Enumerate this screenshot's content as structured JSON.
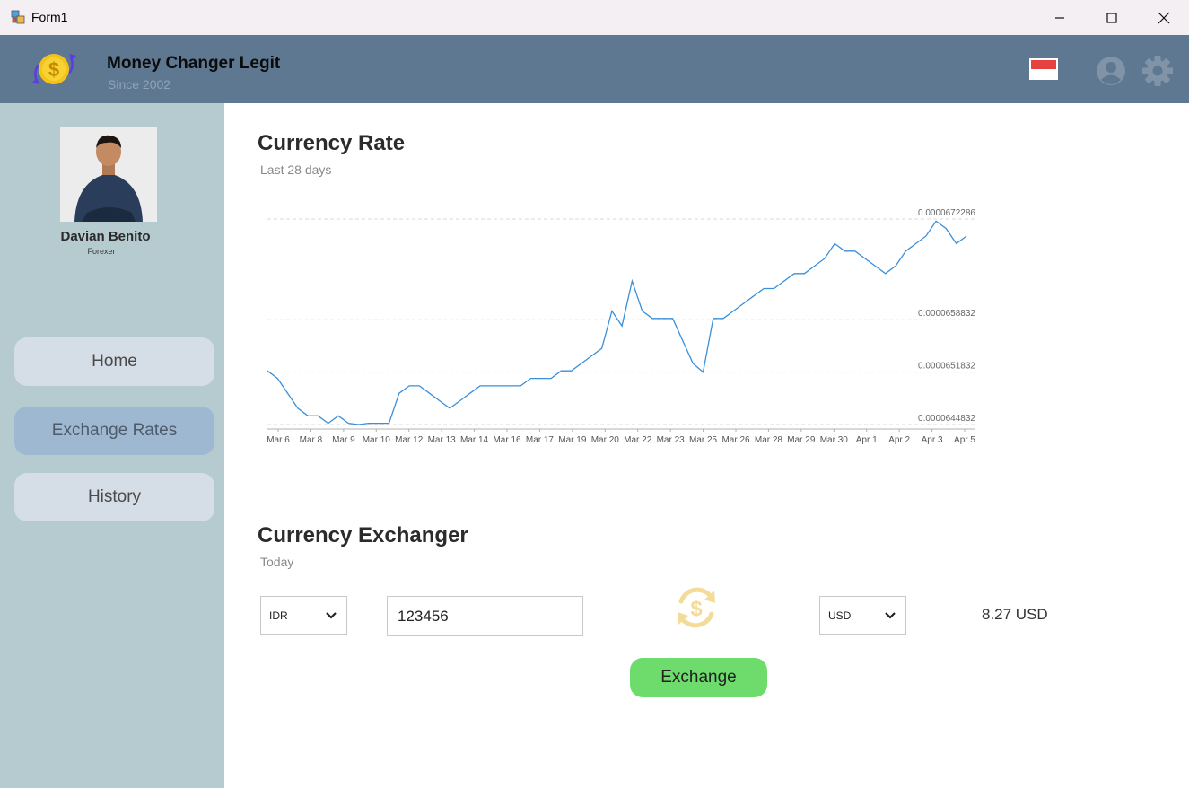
{
  "window": {
    "title": "Form1"
  },
  "header": {
    "brand_title": "Money Changer Legit",
    "brand_subtitle": "Since 2002",
    "flag_colors": [
      "#e5413f",
      "#ffffff"
    ]
  },
  "profile": {
    "name": "Davian Benito",
    "role": "Forexer"
  },
  "nav": [
    {
      "label": "Home",
      "active": false
    },
    {
      "label": "Exchange Rates",
      "active": true
    },
    {
      "label": "History",
      "active": false
    }
  ],
  "rate": {
    "title": "Currency Rate",
    "subtitle": "Last 28 days",
    "chart_data": {
      "type": "line",
      "x_ticks": [
        "Mar 6",
        "Mar 8",
        "Mar 9",
        "Mar 10",
        "Mar 12",
        "Mar 13",
        "Mar 14",
        "Mar 16",
        "Mar 17",
        "Mar 19",
        "Mar 20",
        "Mar 22",
        "Mar 23",
        "Mar 25",
        "Mar 26",
        "Mar 28",
        "Mar 29",
        "Mar 30",
        "Apr 1",
        "Apr 2",
        "Apr 3",
        "Apr 5"
      ],
      "y_ticks": [
        "0.0000672286",
        "0.0000658832",
        "0.0000651832",
        "0.0000644832"
      ],
      "ylim": [
        6.44832e-05,
        6.72286e-05
      ],
      "grid": "horizontal dashed",
      "color": "#3a8fd9",
      "values": [
        6.52e-05,
        6.51e-05,
        6.49e-05,
        6.47e-05,
        6.46e-05,
        6.46e-05,
        6.45e-05,
        6.46e-05,
        6.45e-05,
        6.44832e-05,
        6.45e-05,
        6.45e-05,
        6.45e-05,
        6.49e-05,
        6.5e-05,
        6.5e-05,
        6.49e-05,
        6.48e-05,
        6.47e-05,
        6.48e-05,
        6.49e-05,
        6.5e-05,
        6.5e-05,
        6.5e-05,
        6.5e-05,
        6.5e-05,
        6.51e-05,
        6.51e-05,
        6.51e-05,
        6.52e-05,
        6.52e-05,
        6.53e-05,
        6.54e-05,
        6.55e-05,
        6.6e-05,
        6.58e-05,
        6.64e-05,
        6.6e-05,
        6.59e-05,
        6.59e-05,
        6.59e-05,
        6.56e-05,
        6.53e-05,
        6.51832e-05,
        6.59e-05,
        6.59e-05,
        6.6e-05,
        6.61e-05,
        6.62e-05,
        6.63e-05,
        6.63e-05,
        6.64e-05,
        6.65e-05,
        6.65e-05,
        6.66e-05,
        6.67e-05,
        6.69e-05,
        6.68e-05,
        6.68e-05,
        6.67e-05,
        6.66e-05,
        6.65e-05,
        6.66e-05,
        6.68e-05,
        6.69e-05,
        6.7e-05,
        6.72e-05,
        6.71e-05,
        6.69e-05,
        6.7e-05
      ]
    }
  },
  "exchanger": {
    "title": "Currency Exchanger",
    "subtitle": "Today",
    "from_currency": "IDR",
    "amount": "123456",
    "to_currency": "USD",
    "result": "8.27 USD",
    "exchange_label": "Exchange"
  }
}
